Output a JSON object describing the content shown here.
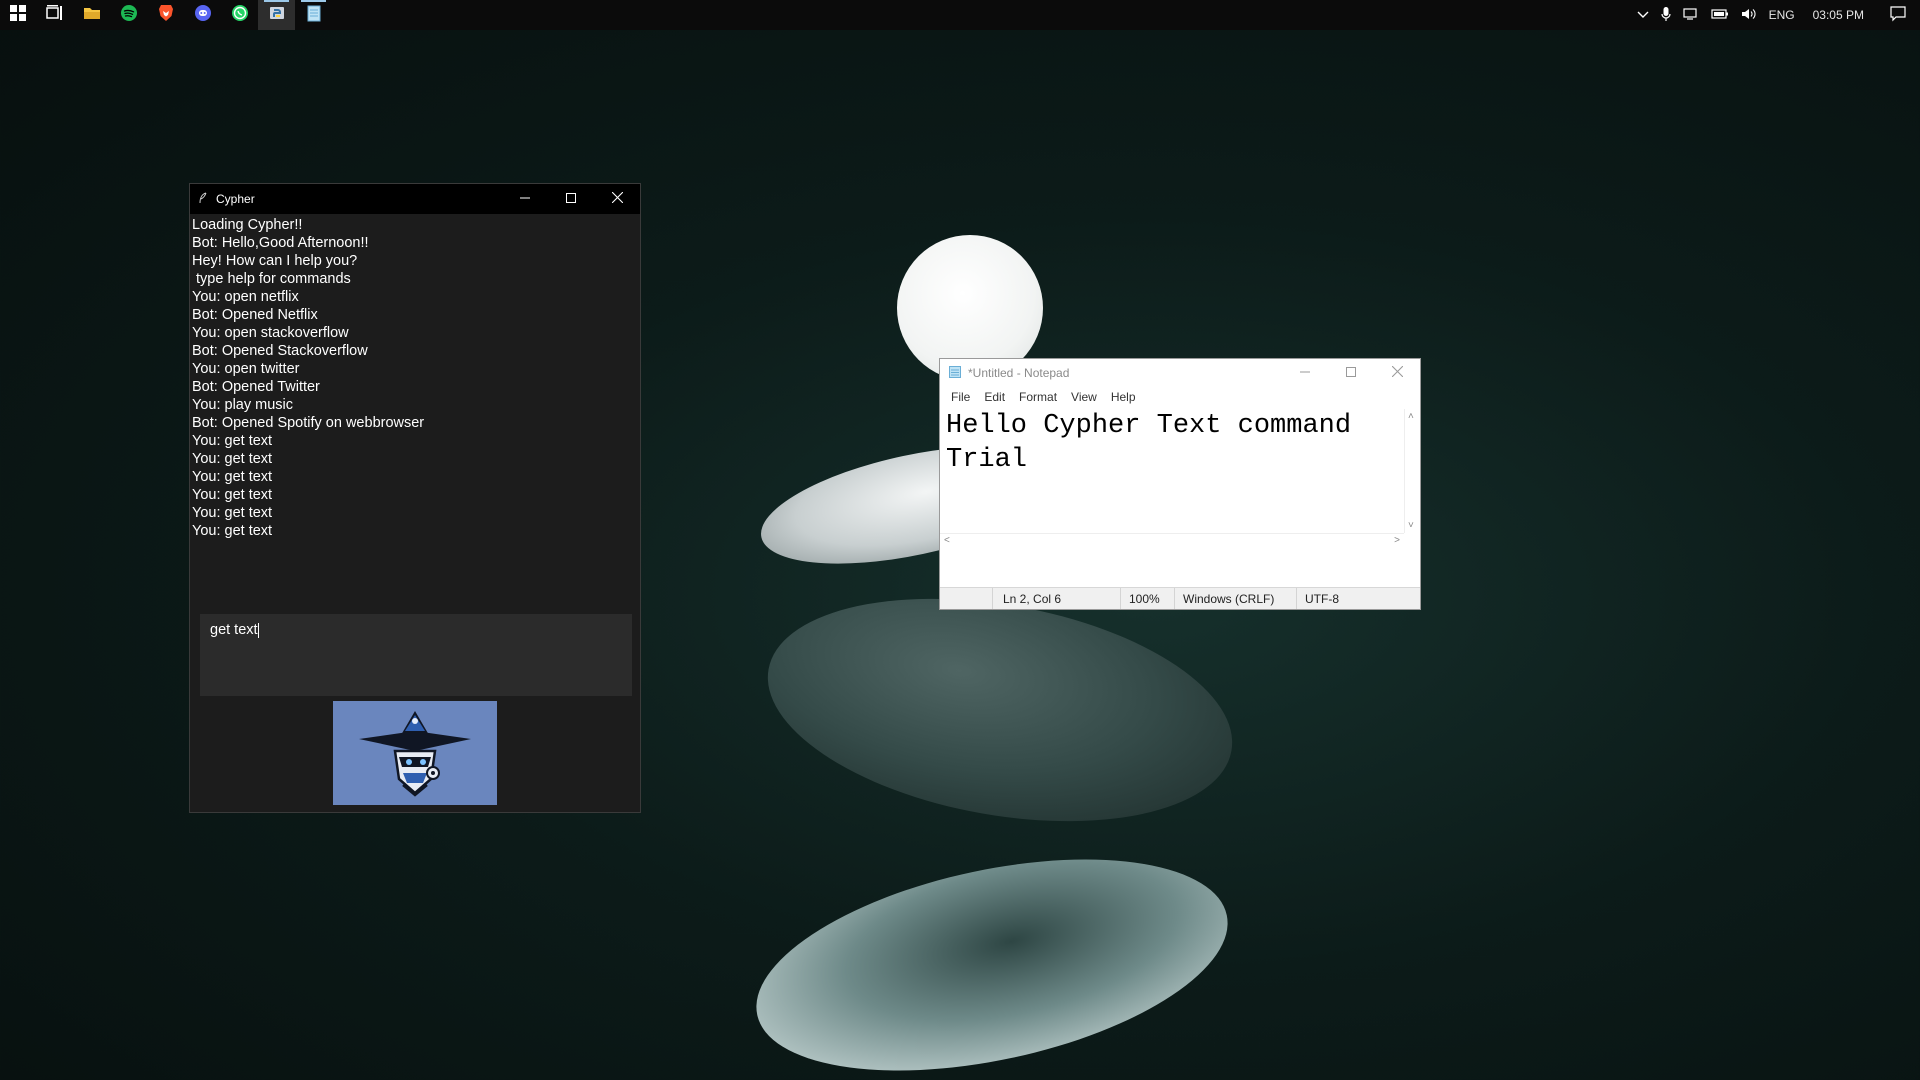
{
  "taskbar": {
    "apps": [
      {
        "name": "start-button",
        "icon": "windows-logo-icon"
      },
      {
        "name": "task-view-button",
        "icon": "task-view-icon"
      },
      {
        "name": "file-explorer-button",
        "icon": "folder-icon"
      },
      {
        "name": "spotify-button",
        "icon": "spotify-icon"
      },
      {
        "name": "brave-button",
        "icon": "brave-lion-icon"
      },
      {
        "name": "discord-button",
        "icon": "discord-icon"
      },
      {
        "name": "whatsapp-button",
        "icon": "whatsapp-icon"
      },
      {
        "name": "python-button",
        "icon": "python-icon"
      },
      {
        "name": "notepad-button",
        "icon": "notepad-icon"
      }
    ],
    "tray": {
      "language": "ENG",
      "time": "03:05 PM"
    }
  },
  "cypher": {
    "title": "Cypher",
    "log": [
      "Loading Cypher!!",
      "Bot: Hello,Good Afternoon!!",
      "Hey! How can I help you?",
      " type help for commands",
      "You: open netflix",
      "Bot: Opened Netflix",
      "You: open stackoverflow",
      "Bot: Opened Stackoverflow",
      "You: open twitter",
      "Bot: Opened Twitter",
      "You: play music",
      "Bot: Opened Spotify on webbrowser",
      "You: get text",
      "You: get text",
      "You: get text",
      "You: get text",
      "You: get text",
      "You: get text"
    ],
    "input_value": "get text",
    "logo_icon": "wizard-hat-robot-icon"
  },
  "notepad": {
    "title": "*Untitled - Notepad",
    "menu": [
      "File",
      "Edit",
      "Format",
      "View",
      "Help"
    ],
    "content": "Hello Cypher Text command\nTrial",
    "status": {
      "position": "Ln 2, Col 6",
      "zoom": "100%",
      "line_endings": "Windows (CRLF)",
      "encoding": "UTF-8"
    }
  },
  "colors": {
    "taskbar": "#0b0b0b",
    "cypher_bg": "#1c1c1c",
    "cypher_input": "#2b2b2b",
    "logo_bg": "#6a86be",
    "desktop": "#0c1b19"
  }
}
